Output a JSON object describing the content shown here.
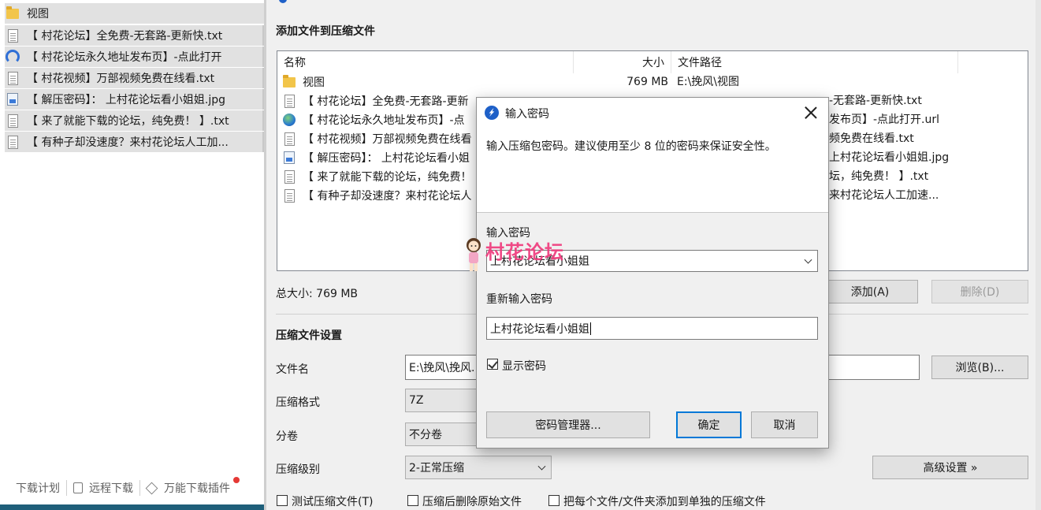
{
  "left_panel": {
    "items": [
      {
        "icon": "folder-icon",
        "label": "视图"
      },
      {
        "icon": "text-file-icon",
        "label": "【 村花论坛】全免费-无套路-更新快.txt"
      },
      {
        "icon": "link-icon",
        "label": "【 村花论坛永久地址发布页】-点此打开"
      },
      {
        "icon": "text-file-icon",
        "label": "【 村花视频】万部视频免费在线看.txt"
      },
      {
        "icon": "image-file-icon",
        "label": "【 解压密码】： 上村花论坛看小姐姐.jpg"
      },
      {
        "icon": "text-file-icon",
        "label": "【 来了就能下载的论坛，纯免费！ 】.txt"
      },
      {
        "icon": "text-file-icon",
        "label": "【 有种子却没速度？来村花论坛人工加..."
      }
    ],
    "footer": {
      "download_plan": "下载计划",
      "remote_download": "远程下载",
      "plugin": "万能下载插件"
    }
  },
  "main": {
    "section_title": "添加文件到压缩文件",
    "columns": {
      "name": "名称",
      "size": "大小",
      "path": "文件路径"
    },
    "files": [
      {
        "icon": "folder-icon",
        "name": "视图",
        "size": "769 MB",
        "path": "E:\\挽风\\视图"
      },
      {
        "icon": "text-file-icon",
        "name": "【 村花论坛】全免费-无套路-更新快.txt",
        "size": "",
        "path": "【 村花论坛】全免费-无套路-更新快.txt"
      },
      {
        "icon": "globe-icon",
        "name": "【 村花论坛永久地址发布页】-点此打开.url",
        "size": "",
        "path": "【 村花论坛永久地址发布页】-点此打开.url"
      },
      {
        "icon": "text-file-icon",
        "name": "【 村花视频】万部视频免费在线看.txt",
        "size": "",
        "path": "【 村花视频】万部视频免费在线看.txt"
      },
      {
        "icon": "image-file-icon",
        "name": "【 解压密码】： 上村花论坛看小姐姐.jpg",
        "size": "",
        "path": "【 解压密码】： 上村花论坛看小姐姐.jpg"
      },
      {
        "icon": "text-file-icon",
        "name": "【 来了就能下载的论坛，纯免费！ 】.txt",
        "size": "",
        "path": "【 来了就能下载的论坛，纯免费！ 】.txt"
      },
      {
        "icon": "text-file-icon",
        "name": "【 有种子却没速度？来村花论坛人工加速...",
        "size": "",
        "path": "【 有种子却没速度？来村花论坛人工加速..."
      }
    ],
    "path_visible": [
      "E:\\挽风\\视图",
      "-无套路-更新快.txt",
      "发布页】-点此打开.url",
      "频免费在线看.txt",
      "上村花论坛看小姐姐.jpg",
      "坛，纯免费！ 】.txt",
      "来村花论坛人工加速..."
    ],
    "name_visible": [
      "视图",
      "【 村花论坛】全免费-无套路-更新",
      "【 村花论坛永久地址发布页】-点",
      "【 村花视频】万部视频免费在线看",
      "【 解压密码】： 上村花论坛看小姐",
      "【 来了就能下载的论坛，纯免费！",
      "【 有种子却没速度？来村花论坛人"
    ],
    "total_size": "总大小: 769 MB",
    "add_button": "添加(A)",
    "delete_button": "删除(D)",
    "settings_title": "压缩文件设置",
    "filename_label": "文件名",
    "filename_value": "E:\\挽风\\挽风.",
    "browse_button": "浏览(B)...",
    "format_label": "压缩格式",
    "format_value": "7Z",
    "volume_label": "分卷",
    "volume_value": "不分卷",
    "level_label": "压缩级别",
    "level_value": "2-正常压缩",
    "advanced_button": "高级设置 »",
    "options": {
      "test": "测试压缩文件(T)",
      "delete_after": "压缩后删除原始文件",
      "separate": "把每个文件/文件夹添加到单独的压缩文件"
    }
  },
  "dialog": {
    "title": "输入密码",
    "description": "输入压缩包密码。建议使用至少 8 位的密码来保证安全性。",
    "password_label": "输入密码",
    "password_value": "上村花论坛看小姐姐",
    "repeat_label": "重新输入密码",
    "repeat_value": "上村花论坛看小姐姐",
    "show_password_label": "显示密码",
    "show_password_checked": true,
    "manager_button": "密码管理器...",
    "ok_button": "确定",
    "cancel_button": "取消"
  },
  "watermark": {
    "text": "村花论坛"
  },
  "colors": {
    "accent": "#0078d7",
    "watermark": "#ef3b7d",
    "footer_bar": "#1f5f7a"
  }
}
